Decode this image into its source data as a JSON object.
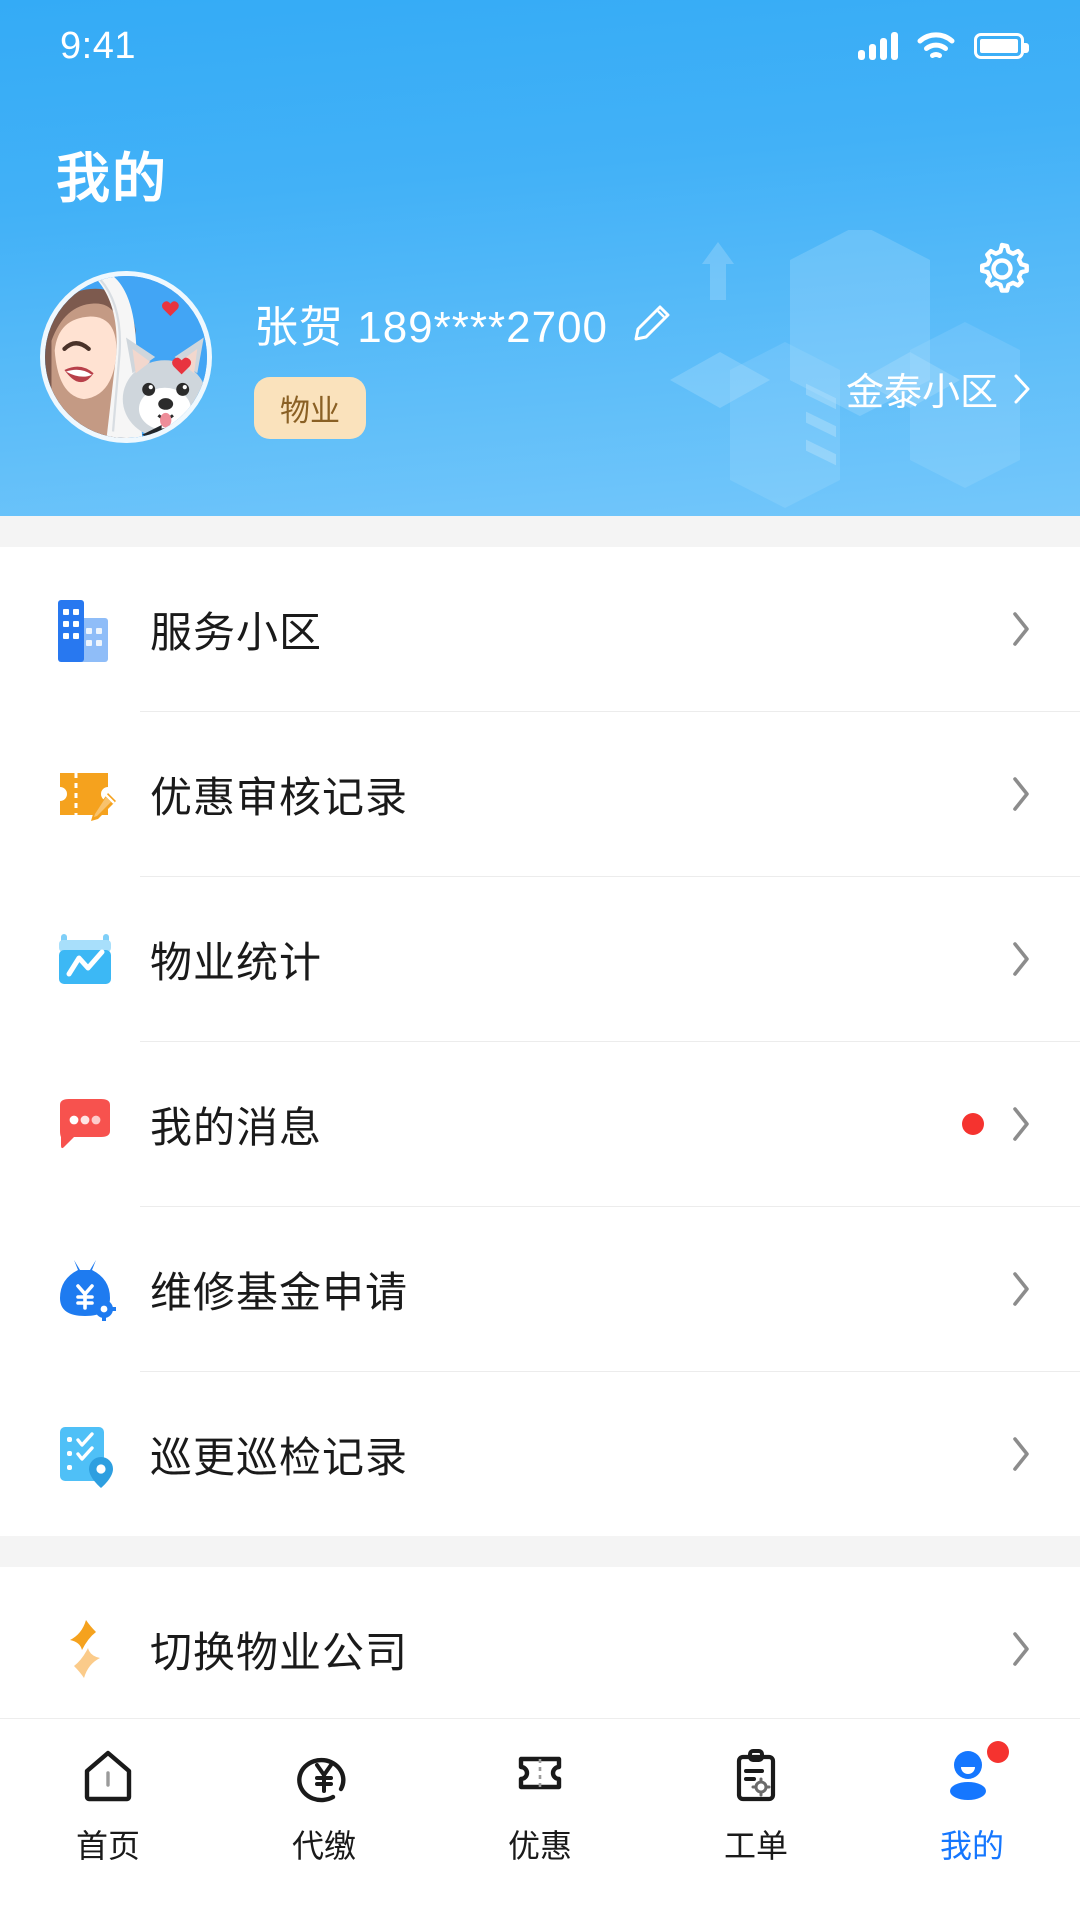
{
  "statusbar": {
    "time": "9:41",
    "signal_icon": "signal-bars-icon",
    "wifi_icon": "wifi-icon",
    "battery_icon": "battery-icon"
  },
  "header": {
    "title": "我的",
    "gear_icon": "gear-icon",
    "background_decoration": "isometric-buildings-watermark",
    "accent_color": "#35ACF6"
  },
  "profile": {
    "avatar_icon": "avatar-anime-girl-with-dog",
    "name_and_phone": "张贺 189****2700",
    "edit_icon": "pencil-edit-icon",
    "role_badge": "物业",
    "badge_bg": "#FAE2BC",
    "badge_text_color": "#8A6024",
    "community_name": "金泰小区",
    "community_chevron_icon": "chevron-right-icon"
  },
  "menu_groups": [
    {
      "items": [
        {
          "label": "服务小区",
          "icon": "building-icon",
          "color": "#2878F0",
          "badge": false
        },
        {
          "label": "优惠审核记录",
          "icon": "ticket-edit-icon",
          "color": "#F5A21E",
          "badge": false
        },
        {
          "label": "物业统计",
          "icon": "calendar-chart-icon",
          "color": "#3CB8F5",
          "badge": false
        },
        {
          "label": "我的消息",
          "icon": "message-bubble-icon",
          "color": "#F7524E",
          "badge": true
        },
        {
          "label": "维修基金申请",
          "icon": "money-bag-gear-icon",
          "color": "#1E7BF0",
          "badge": false
        },
        {
          "label": "巡更巡检记录",
          "icon": "checklist-location-icon",
          "color": "#4FC0F7",
          "badge": false
        }
      ]
    },
    {
      "items": [
        {
          "label": "切换物业公司",
          "icon": "swap-arrows-icon",
          "color": "#F5A21E",
          "badge": false
        }
      ]
    }
  ],
  "list_common": {
    "arrow_icon": "chevron-right-icon",
    "arrow_color": "#8c8c8c",
    "badge_color": "#F5332F"
  },
  "tabbar": {
    "active_color": "#1577FF",
    "inactive_color": "#1a1a1a",
    "tabs": [
      {
        "label": "首页",
        "icon": "home-icon",
        "active": false,
        "badge": false
      },
      {
        "label": "代缴",
        "icon": "yuan-payment-icon",
        "active": false,
        "badge": false
      },
      {
        "label": "优惠",
        "icon": "ticket-icon",
        "active": false,
        "badge": false
      },
      {
        "label": "工单",
        "icon": "clipboard-gear-icon",
        "active": false,
        "badge": false
      },
      {
        "label": "我的",
        "icon": "person-icon",
        "active": true,
        "badge": true
      }
    ]
  }
}
